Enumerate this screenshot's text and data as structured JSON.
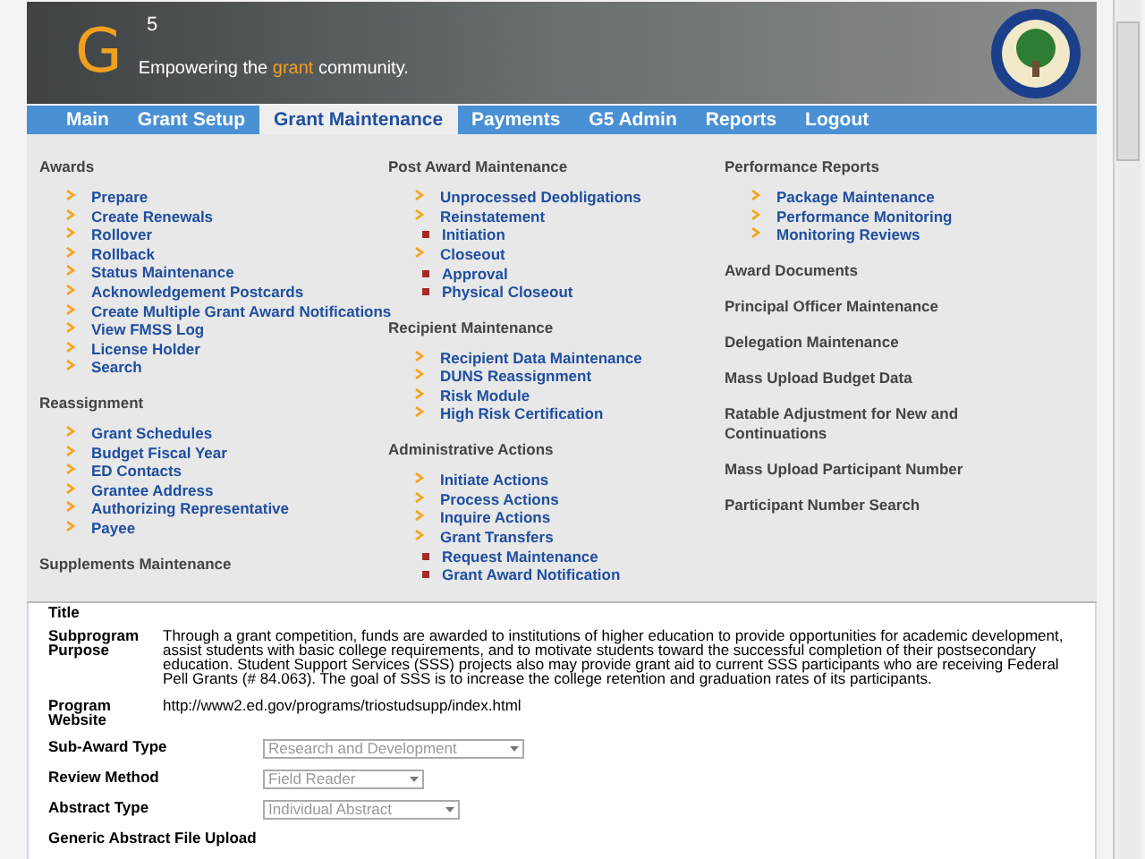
{
  "header": {
    "logo_letter": "G",
    "logo_superscript": "5",
    "tagline_before": "Empowering the ",
    "tagline_highlight": "grant",
    "tagline_after": " community."
  },
  "nav": [
    {
      "label": "Main",
      "selected": false
    },
    {
      "label": "Grant Setup",
      "selected": false
    },
    {
      "label": "Grant Maintenance",
      "selected": true
    },
    {
      "label": "Payments",
      "selected": false
    },
    {
      "label": "G5 Admin",
      "selected": false
    },
    {
      "label": "Reports",
      "selected": false
    },
    {
      "label": "Logout",
      "selected": false
    }
  ],
  "menu": {
    "columns": [
      {
        "sections": [
          {
            "title": "Awards",
            "items": [
              {
                "label": "Prepare"
              },
              {
                "label": "Create Renewals"
              },
              {
                "label": "Rollover"
              },
              {
                "label": "Rollback"
              },
              {
                "label": "Status Maintenance"
              },
              {
                "label": "Acknowledgement Postcards"
              },
              {
                "label": "Create Multiple Grant Award Notifications"
              },
              {
                "label": "View FMSS Log"
              },
              {
                "label": "License Holder"
              },
              {
                "label": "Search"
              }
            ]
          },
          {
            "title": "Reassignment",
            "items": [
              {
                "label": "Grant Schedules"
              },
              {
                "label": "Budget Fiscal Year"
              },
              {
                "label": "ED Contacts"
              },
              {
                "label": "Grantee Address"
              },
              {
                "label": "Authorizing Representative"
              },
              {
                "label": "Payee"
              }
            ]
          },
          {
            "title": "Supplements Maintenance"
          }
        ]
      },
      {
        "sections": [
          {
            "title": "Post Award Maintenance",
            "items": [
              {
                "label": "Unprocessed Deobligations"
              },
              {
                "label": "Reinstatement",
                "children": [
                  {
                    "label": "Initiation"
                  }
                ]
              },
              {
                "label": "Closeout",
                "children": [
                  {
                    "label": "Approval"
                  },
                  {
                    "label": "Physical Closeout"
                  }
                ]
              }
            ]
          },
          {
            "title": "Recipient Maintenance",
            "items": [
              {
                "label": "Recipient Data Maintenance"
              },
              {
                "label": "DUNS Reassignment"
              },
              {
                "label": "Risk Module"
              },
              {
                "label": "High Risk Certification"
              }
            ]
          },
          {
            "title": "Administrative Actions",
            "items": [
              {
                "label": "Initiate Actions"
              },
              {
                "label": "Process Actions"
              },
              {
                "label": "Inquire Actions"
              },
              {
                "label": "Grant Transfers",
                "children": [
                  {
                    "label": "Request Maintenance"
                  },
                  {
                    "label": "Grant Award Notification"
                  }
                ]
              }
            ]
          }
        ]
      },
      {
        "sections": [
          {
            "title": "Performance Reports",
            "items": [
              {
                "label": "Package Maintenance"
              },
              {
                "label": "Performance Monitoring"
              },
              {
                "label": "Monitoring Reviews"
              }
            ]
          },
          {
            "title": "Award Documents"
          },
          {
            "title": "Principal Officer Maintenance"
          },
          {
            "title": "Delegation Maintenance"
          },
          {
            "title": "Mass Upload Budget Data"
          },
          {
            "title": "Ratable Adjustment for New and Continuations"
          },
          {
            "title": "Mass Upload Participant Number"
          },
          {
            "title": "Participant Number Search"
          }
        ]
      }
    ]
  },
  "form": [
    {
      "kind": "text",
      "label": "Title"
    },
    {
      "kind": "text",
      "label": "Subprogram Purpose",
      "value": "Through a grant competition, funds are awarded to institutions of higher education to provide opportunities for academic development, assist students with basic college requirements, and to motivate students toward the successful completion of their postsecondary education. Student Support Services (SSS) projects also may provide grant aid to current SSS participants who are receiving Federal Pell Grants (# 84.063). The goal of SSS is to increase the college retention and graduation rates of its participants."
    },
    {
      "kind": "text",
      "label": "Program Website",
      "value": "http://www2.ed.gov/programs/triostudsupp/index.html"
    },
    {
      "kind": "select",
      "label": "Sub-Award Type",
      "value": "Research and Development",
      "disabled": true
    },
    {
      "kind": "select",
      "label": "Review Method",
      "value": "Field Reader",
      "disabled": true
    },
    {
      "kind": "select",
      "label": "Abstract Type",
      "value": "Individual Abstract",
      "disabled": true
    },
    {
      "kind": "text",
      "label": "Generic Abstract File Upload"
    }
  ]
}
